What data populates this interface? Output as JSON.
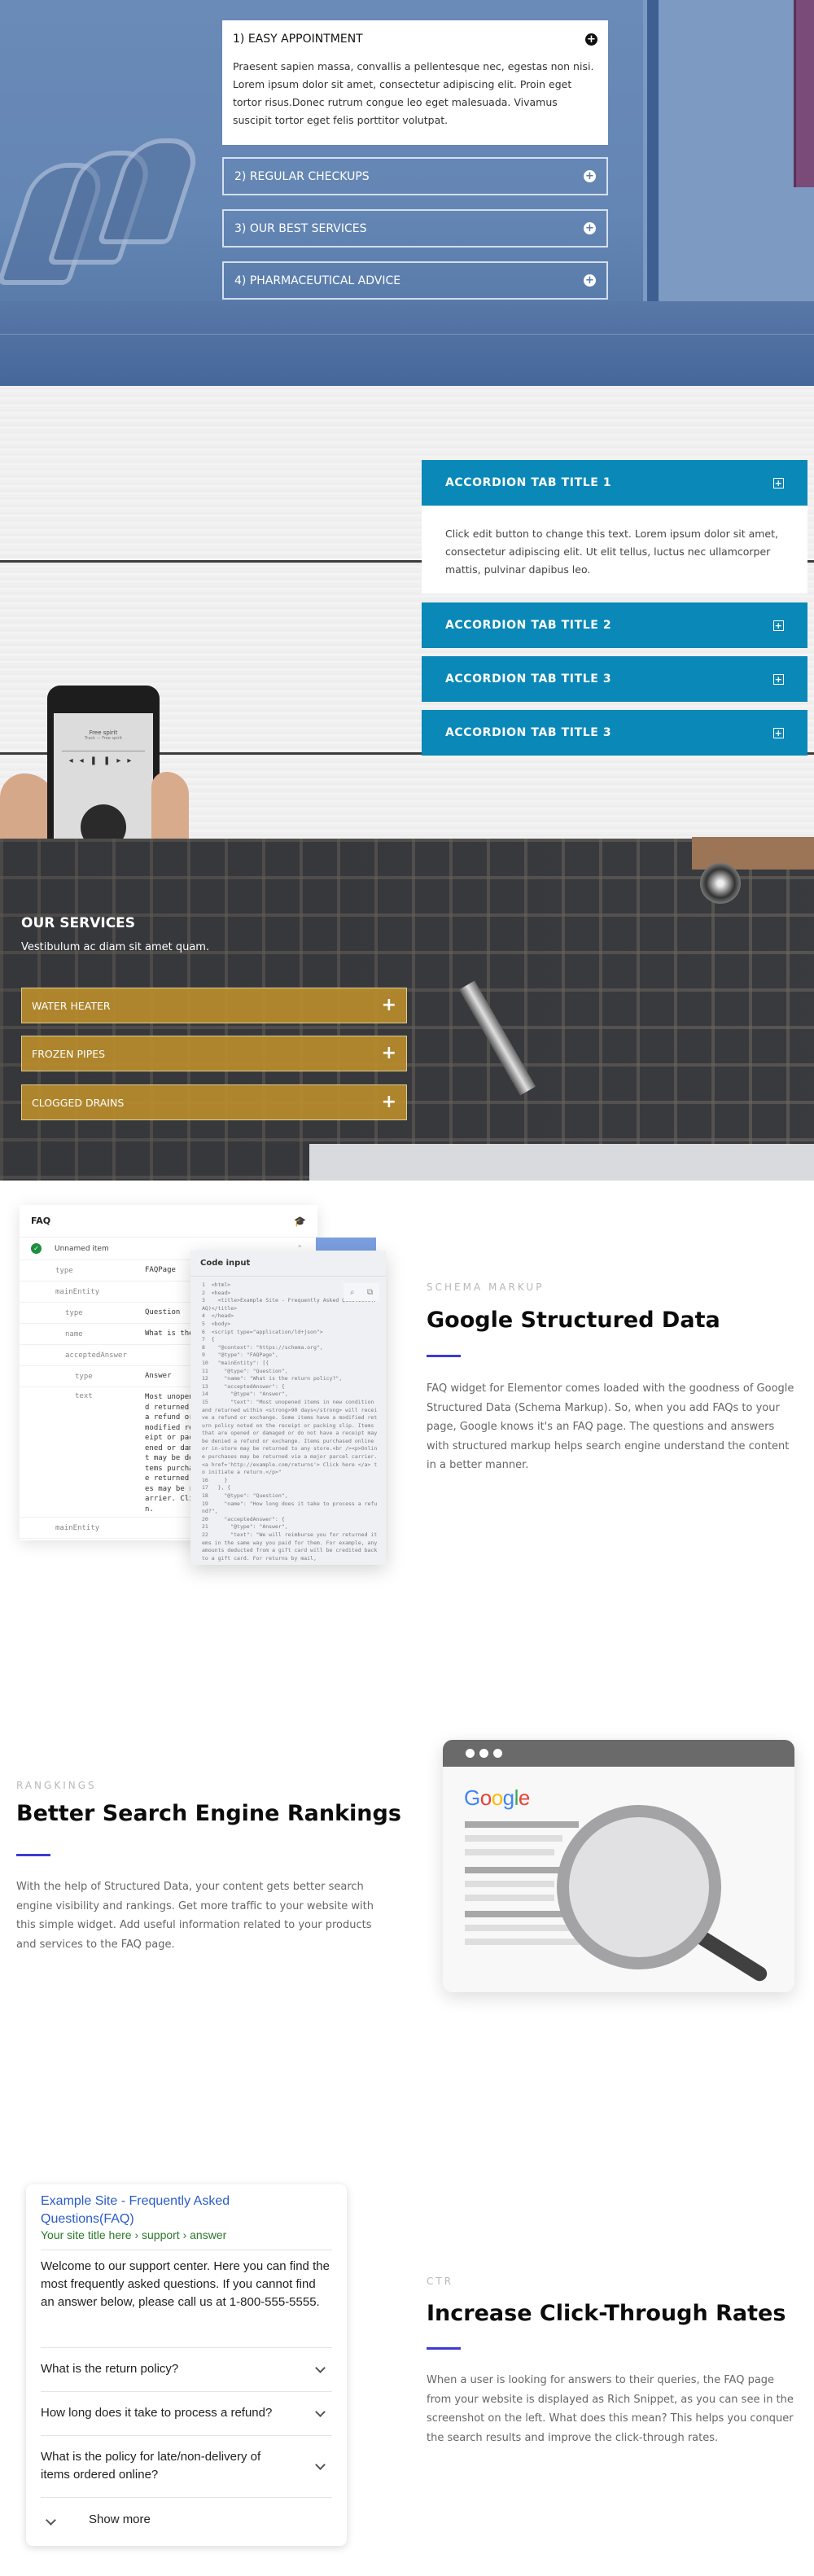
{
  "section_hospital_accordion": {
    "items": [
      {
        "title": "1) EASY APPOINTMENT",
        "open": true,
        "body": "Praesent sapien massa, convallis a pellentesque nec, egestas non nisi. Lorem ipsum dolor sit amet, consectetur adipiscing elit. Proin eget tortor risus.Donec rutrum congue leo eget malesuada. Vivamus suscipit tortor eget felis porttitor volutpat."
      },
      {
        "title": "2) REGULAR CHECKUPS",
        "open": false
      },
      {
        "title": "3) OUR BEST SERVICES",
        "open": false
      },
      {
        "title": "4) PHARMACEUTICAL ADVICE",
        "open": false
      }
    ],
    "icon": "plus-circle-icon",
    "background_color": "#6486b4"
  },
  "section_wood_accordion": {
    "items": [
      {
        "title": "ACCORDION TAB TITLE 1",
        "open": true,
        "body": "Click edit button to change this text. Lorem ipsum dolor sit amet, consectetur adipiscing elit. Ut elit tellus, luctus nec ullamcorper mattis, pulvinar dapibus leo."
      },
      {
        "title": "ACCORDION TAB TITLE 2",
        "open": false
      },
      {
        "title": "ACCORDION TAB TITLE 3",
        "open": false
      },
      {
        "title": "ACCORDION TAB TITLE 3",
        "open": false
      }
    ],
    "icon": "plus-square-icon",
    "accent_color": "#0a88b8",
    "phone_screen": {
      "song": "Free spirit",
      "artist": "Track — Free spirit"
    }
  },
  "section_services": {
    "title": "OUR SERVICES",
    "subtitle": "Vestibulum ac diam sit amet quam.",
    "items": [
      {
        "title": "WATER HEATER"
      },
      {
        "title": "FROZEN PIPES"
      },
      {
        "title": "CLOGGED DRAINS"
      }
    ],
    "icon": "plus-icon",
    "accent_color": "#b88c2c"
  },
  "section_schema": {
    "eyebrow": "SCHEMA MARKUP",
    "heading": "Google Structured Data",
    "paragraph": "FAQ widget for Elementor comes loaded with the goodness of Google Structured Data (Schema Markup). So, when you add FAQs to your page, Google knows it's an FAQ page. The questions and answers with structured markup helps search engine understand the content in a better manner.",
    "faq_card": {
      "title": "FAQ",
      "item_label": "Unnamed item",
      "rows": [
        {
          "key": "type",
          "value": "FAQPage",
          "indent": 0
        },
        {
          "key": "mainEntity",
          "value": "",
          "indent": 0
        },
        {
          "key": "type",
          "value": "Question",
          "indent": 1
        },
        {
          "key": "name",
          "value": "What is the",
          "indent": 1
        },
        {
          "key": "acceptedAnswer",
          "value": "",
          "indent": 1
        },
        {
          "key": "type",
          "value": "Answer",
          "indent": 2
        },
        {
          "key": "text",
          "value": "Most unopene\nd returned w\na refund or\nmodified ret\neipt or pack\nened or dama\nt may be den\ntems purchas\ne returned t\nes may be re\narrier. Clic\nn.",
          "indent": 2
        },
        {
          "key": "mainEntity",
          "value": "",
          "indent": 0
        }
      ]
    },
    "code_card": {
      "title": "Code input",
      "code": "1  <html>\n2  <head>\n3    <title>Example Site - Frequently Asked Questions(FAQ)</title>\n4  </head>\n5  <body>\n6  <script type=\"application/ld+json\">\n7  {\n8    \"@context\": \"https://schema.org\",\n9    \"@type\": \"FAQPage\",\n10   \"mainEntity\": [{\n11     \"@type\": \"Question\",\n12     \"name\": \"What is the return policy?\",\n13     \"acceptedAnswer\": {\n14       \"@type\": \"Answer\",\n15       \"text\": \"Most unopened items in new condition and returned within <strong>90 days</strong> will receive a refund or exchange. Some items have a modified return policy noted on the receipt or packing slip. Items that are opened or damaged or do not have a receipt may be denied a refund or exchange. Items purchased online or in-store may be returned to any store.<br /><p>Online purchases may be returned via a major parcel carrier. <a href='http://example.com/returns'> Click here </a> to initiate a return.</p>\"\n16     }\n17   }, {\n18     \"@type\": \"Question\",\n19     \"name\": \"How long does it take to process a refund?\",\n20     \"acceptedAnswer\": {\n21       \"@type\": \"Answer\",\n22       \"text\": \"We will reimburse you for returned items in the same way you paid for them. For example, any amounts deducted from a gift card will be credited back to a gift card. For returns by mail,"
    }
  },
  "section_rankings": {
    "eyebrow": "RANGKINGS",
    "heading": "Better Search Engine Rankings",
    "paragraph": "With the help of Structured Data, your content gets better search engine visibility and rankings. Get more traffic to your website with this simple widget. Add useful information related to your products and services to the FAQ page.",
    "illustration": {
      "logo_text": "Google",
      "logo_colors": [
        "#4285f4",
        "#ea4335",
        "#fbbc05",
        "#4285f4",
        "#34a853",
        "#ea4335"
      ]
    }
  },
  "section_ctr": {
    "eyebrow": "CTR",
    "heading": "Increase Click-Through Rates",
    "paragraph": "When a user is looking for answers to their queries, the FAQ page from your website is displayed as Rich Snippet, as you can see in the screenshot on the left. What does this mean? This helps you conquer the search results and improve the click-through rates.",
    "snippet": {
      "title": "Example Site - Frequently Asked Questions(FAQ)",
      "breadcrumb": "Your site title here › support › answer",
      "description": "Welcome to our support center. Here you can find the most frequently asked questions. If you cannot find an answer below, please call us at 1-800-555-5555.",
      "questions": [
        "What is the return policy?",
        "How long does it take to process a refund?",
        "What is the policy for late/non-delivery of items ordered online?"
      ],
      "show_more": "Show more"
    }
  },
  "accent_bar_color": "#3b3bd6"
}
